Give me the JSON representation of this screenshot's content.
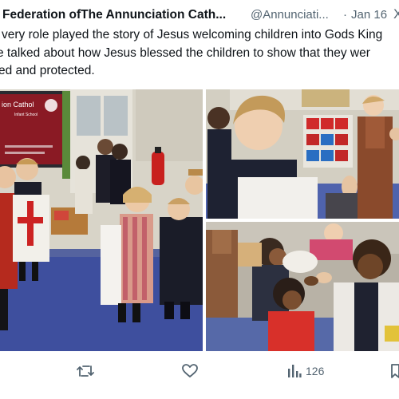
{
  "tweet": {
    "author_name": "Federation ofThe Annunciation Cath...",
    "handle": "@Annunciati...",
    "separator": "·",
    "date": "Jan 16",
    "more_label": "X",
    "text_lines": [
      "very role played the story of Jesus welcoming children into Gods King",
      "e talked about how Jesus blessed the children  to show that they wer",
      "ed and protected."
    ],
    "classroom_sign": {
      "line1": "ion Cathol",
      "line2": "Infant School"
    }
  },
  "actions": {
    "retweet_icon": "retweet-icon",
    "like_icon": "heart-icon",
    "views_icon": "views-bar-icon",
    "views_count": "126",
    "bookmark_icon": "bookmark-icon"
  },
  "colors": {
    "text_primary": "#0f1419",
    "text_secondary": "#536471",
    "background": "#ffffff"
  }
}
